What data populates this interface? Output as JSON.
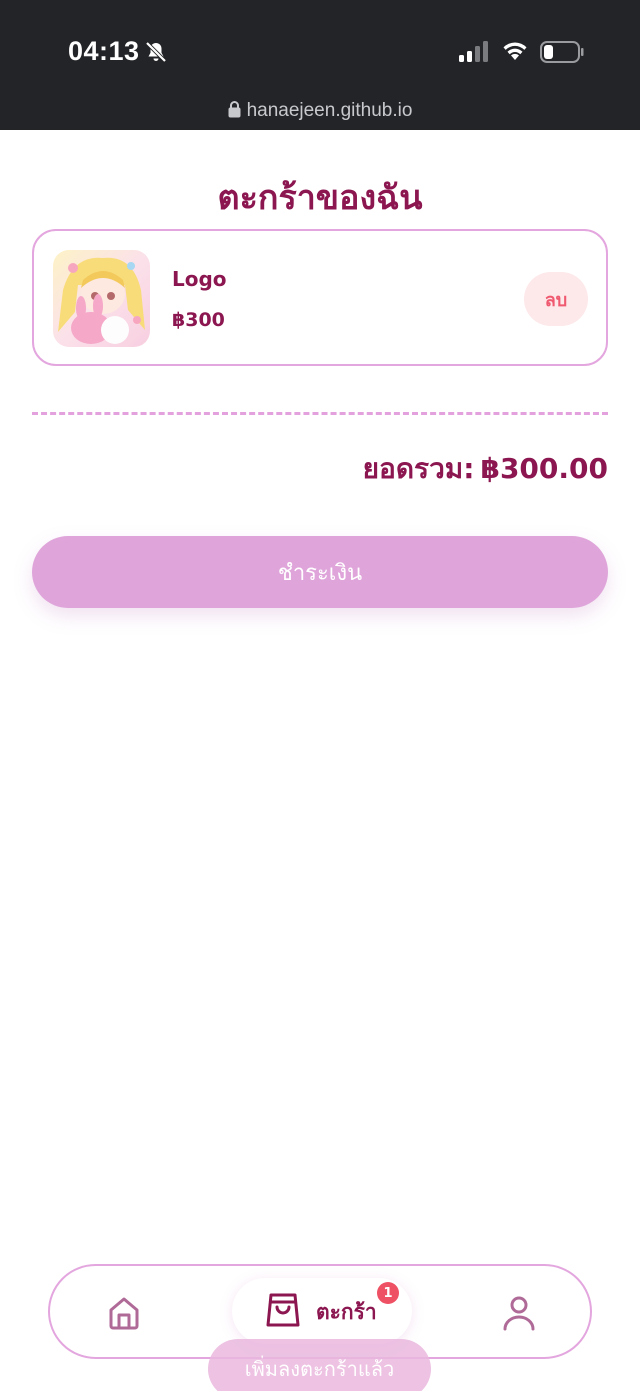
{
  "status_bar": {
    "time": "04:13",
    "url": "hanaejeen.github.io",
    "icons": [
      "bell-off-icon",
      "signal-icon",
      "wifi-icon",
      "battery-icon",
      "lock-icon"
    ]
  },
  "page": {
    "title": "ตะกร้าของฉัน"
  },
  "cart": {
    "items": [
      {
        "name": "Logo",
        "price": "฿300",
        "delete_label": "ลบ"
      }
    ],
    "total_label": "ยอดรวม:",
    "total_value": "฿300.00",
    "checkout_label": "ชำระเงิน"
  },
  "bottom_nav": {
    "cart_label": "ตะกร้า",
    "cart_badge": "1",
    "icons": [
      "home-icon",
      "shopping-bag-icon",
      "user-icon"
    ]
  },
  "toast": {
    "message": "เพิ่มลงตะกร้าแล้ว"
  },
  "colors": {
    "primary": "#8b1650",
    "accent": "#dfa5da",
    "border": "#e3a6de",
    "danger": "#f05a70",
    "status_bg": "#232427"
  }
}
